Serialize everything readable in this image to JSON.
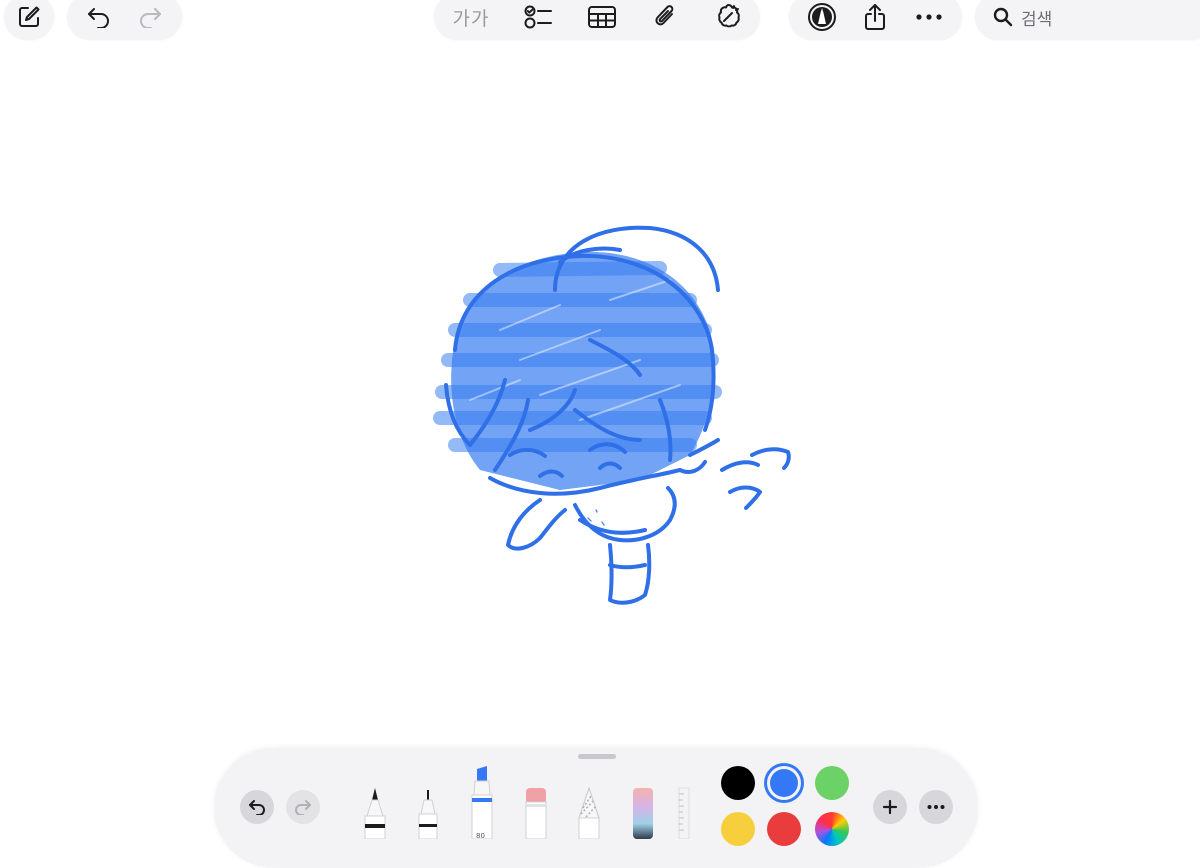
{
  "toolbar": {
    "compose_icon": "compose-icon",
    "undo_icon": "undo-icon",
    "redo_icon": "redo-icon",
    "format_label": "가가",
    "checklist_icon": "checklist-icon",
    "table_icon": "table-icon",
    "attachment_icon": "paperclip-icon",
    "ai_icon": "apple-intelligence-icon",
    "markup_icon": "markup-pen-icon",
    "share_icon": "share-icon",
    "more_icon": "more-icon",
    "search_placeholder": "검색"
  },
  "canvas": {
    "ink_color": "#2f6fe8",
    "highlight_color": "#3b7ff0"
  },
  "palette": {
    "tools": [
      "pen",
      "fineliner",
      "highlighter",
      "eraser",
      "lasso",
      "crayon",
      "ruler"
    ],
    "selected_tool": "highlighter",
    "highlighter_width_label": "80",
    "colors": [
      "#000000",
      "#3478f6",
      "#6cd167",
      "#f7cf3c",
      "#e93c3c",
      "color-wheel"
    ],
    "selected_color": "#3478f6",
    "add_icon": "plus-icon",
    "more_icon": "more-icon"
  }
}
